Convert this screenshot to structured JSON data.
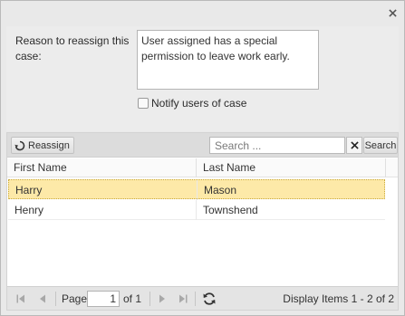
{
  "form": {
    "reason_label": "Reason to reassign this case:",
    "reason_value": "User assigned has a special permission to leave work early.",
    "notify_label": "Notify users of case",
    "notify_checked": false
  },
  "toolbar": {
    "reassign_label": "Reassign",
    "search_placeholder": "Search ...",
    "search_label": "Search"
  },
  "grid": {
    "columns": [
      "First Name",
      "Last Name"
    ],
    "rows": [
      {
        "first": "Harry",
        "last": "Mason",
        "selected": true
      },
      {
        "first": "Henry",
        "last": "Townshend",
        "selected": false
      }
    ]
  },
  "pager": {
    "page_label": "Page",
    "current_page": "1",
    "of_label": "of 1",
    "display_label": "Display Items 1 - 2 of 2"
  },
  "colors": {
    "selected_row": "#fde9a8",
    "toolbar_bg": "#dcdcdc",
    "dialog_bg": "#e9e9e9"
  }
}
